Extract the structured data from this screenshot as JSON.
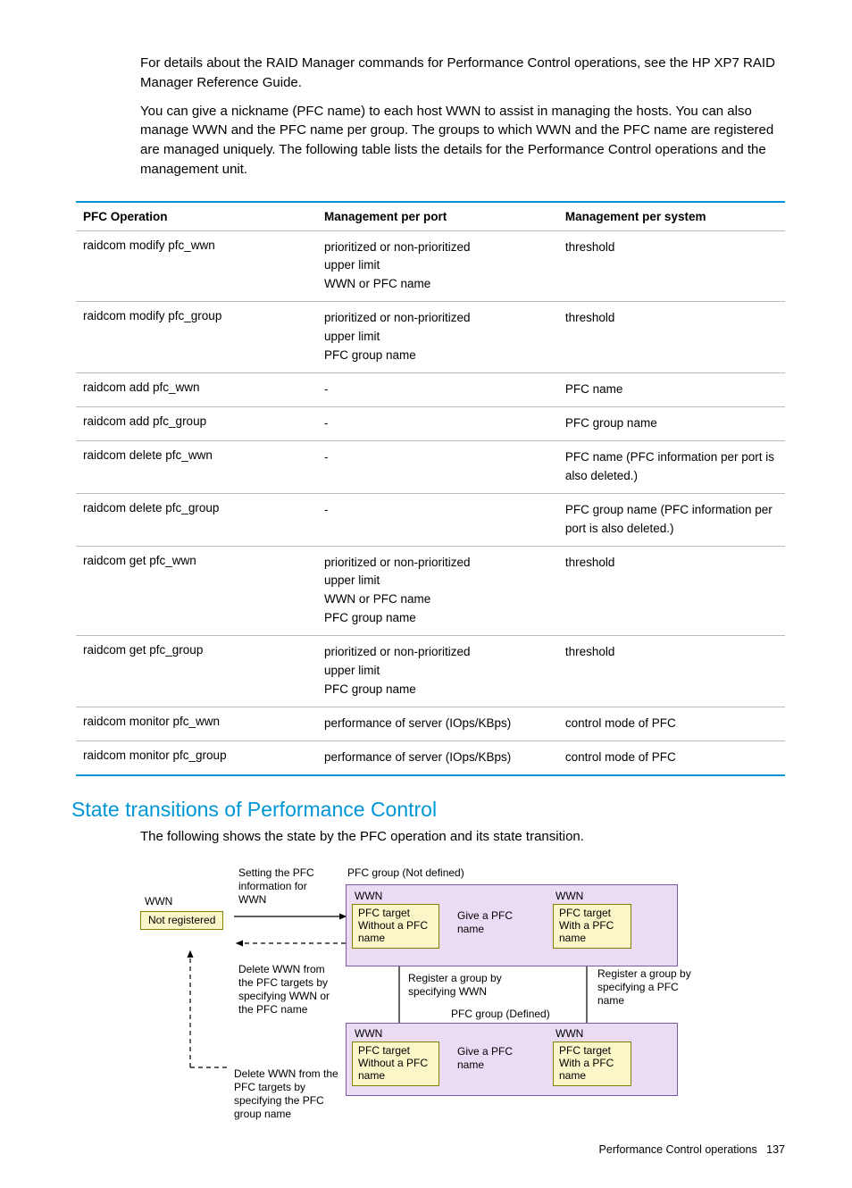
{
  "paragraphs": {
    "p1": "For details about the RAID Manager commands for Performance Control operations, see the HP XP7 RAID Manager Reference Guide.",
    "p2": "You can give a nickname (PFC name) to each host WWN to assist in managing the hosts. You can also manage WWN and the PFC name per group. The groups to which WWN and the PFC name are registered are managed uniquely. The following table lists the details for the Performance Control operations and the management unit.",
    "p3": "The following shows the state by the PFC operation and its state transition."
  },
  "table": {
    "headers": [
      "PFC Operation",
      "Management per port",
      "Management per system"
    ],
    "rows": [
      {
        "op": "raidcom modify pfc_wwn",
        "port": [
          "prioritized or non-prioritized",
          "upper limit",
          "WWN or PFC name"
        ],
        "sys": [
          "threshold"
        ]
      },
      {
        "op": "raidcom modify pfc_group",
        "port": [
          "prioritized or non-prioritized",
          "upper limit",
          "PFC group name"
        ],
        "sys": [
          "threshold"
        ]
      },
      {
        "op": "raidcom add pfc_wwn",
        "port": [
          "-"
        ],
        "sys": [
          "PFC name"
        ]
      },
      {
        "op": "raidcom add pfc_group",
        "port": [
          "-"
        ],
        "sys": [
          "PFC group name"
        ]
      },
      {
        "op": "raidcom delete pfc_wwn",
        "port": [
          "-"
        ],
        "sys": [
          "PFC name (PFC information per port is also deleted.)"
        ]
      },
      {
        "op": "raidcom delete pfc_group",
        "port": [
          "-"
        ],
        "sys": [
          "PFC group name (PFC information per port is also deleted.)"
        ]
      },
      {
        "op": "raidcom get pfc_wwn",
        "port": [
          "prioritized or non-prioritized",
          "upper limit",
          "WWN or PFC name",
          "PFC group name"
        ],
        "sys": [
          "threshold"
        ]
      },
      {
        "op": "raidcom get pfc_group",
        "port": [
          "prioritized or non-prioritized",
          "upper limit",
          "PFC group name"
        ],
        "sys": [
          "threshold"
        ]
      },
      {
        "op": "raidcom monitor pfc_wwn",
        "port": [
          "performance of server (IOps/KBps)"
        ],
        "sys": [
          "control mode of PFC"
        ]
      },
      {
        "op": "raidcom monitor pfc_group",
        "port": [
          "performance of server (IOps/KBps)"
        ],
        "sys": [
          "control mode of PFC"
        ]
      }
    ]
  },
  "section_heading": "State transitions of Performance Control",
  "diagram": {
    "top_set_info": "Setting the PFC information for WWN",
    "top_group_undef": "PFC group (Not defined)",
    "top_group_def": "PFC group (Defined)",
    "wwn": "WWN",
    "not_registered": "Not registered",
    "delete_by_wwn": "Delete WWN from the PFC targets by specifying WWN or the PFC name",
    "delete_by_group": "Delete WWN from the PFC targets by specifying the PFC group name",
    "pfc_target": "PFC target",
    "without_name": "Without a  PFC name",
    "without_name2": "Without a PFC name",
    "with_name": "With a PFC name",
    "give_name": "Give a PFC name",
    "register_wwn": "Register a group by specifying WWN",
    "register_pfc": "Register a group by specifying a PFC name"
  },
  "footer": {
    "label": "Performance Control operations",
    "page": "137"
  }
}
